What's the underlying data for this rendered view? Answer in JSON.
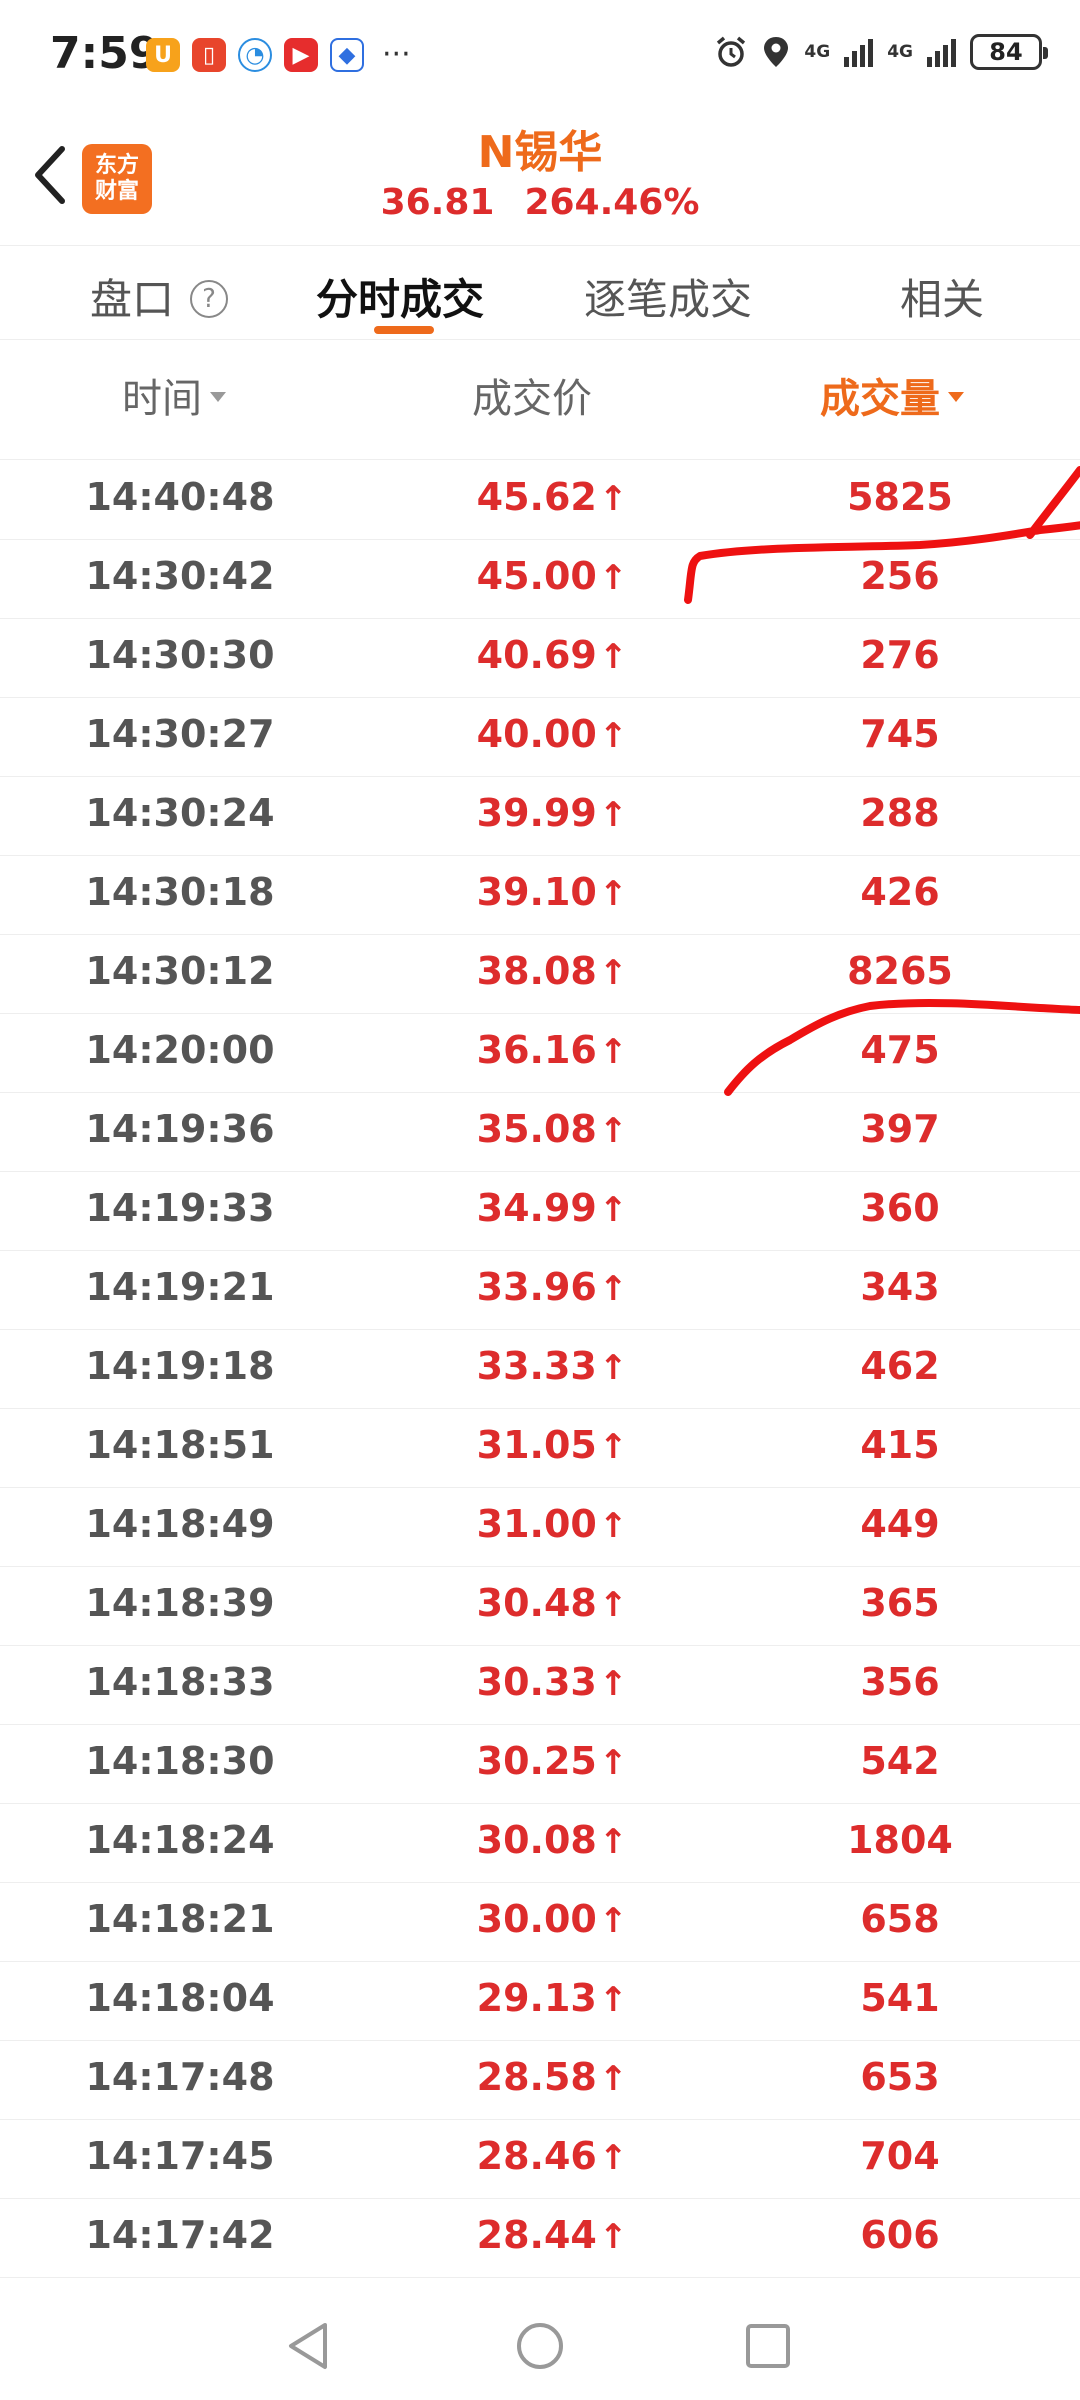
{
  "status_bar": {
    "time": "7:59",
    "apps": [
      "app-u-icon",
      "app-record-icon",
      "app-chat-icon",
      "app-video-icon",
      "app-map-icon"
    ],
    "more": "···",
    "network1": "4G",
    "network2": "4G",
    "battery": "84"
  },
  "header": {
    "logo_line1": "东方",
    "logo_line2": "财富",
    "title": "N锡华",
    "price": "36.81",
    "change_pct": "264.46%"
  },
  "tabs": {
    "pankou": "盘口",
    "help": "?",
    "fenshi": "分时成交",
    "zhubi": "逐笔成交",
    "xiangguan": "相关"
  },
  "columns": {
    "time": "时间",
    "price": "成交价",
    "volume": "成交量"
  },
  "trades": [
    {
      "time": "14:40:48",
      "price": "45.62",
      "volume": "5825"
    },
    {
      "time": "14:30:42",
      "price": "45.00",
      "volume": "256"
    },
    {
      "time": "14:30:30",
      "price": "40.69",
      "volume": "276"
    },
    {
      "time": "14:30:27",
      "price": "40.00",
      "volume": "745"
    },
    {
      "time": "14:30:24",
      "price": "39.99",
      "volume": "288"
    },
    {
      "time": "14:30:18",
      "price": "39.10",
      "volume": "426"
    },
    {
      "time": "14:30:12",
      "price": "38.08",
      "volume": "8265"
    },
    {
      "time": "14:20:00",
      "price": "36.16",
      "volume": "475"
    },
    {
      "time": "14:19:36",
      "price": "35.08",
      "volume": "397"
    },
    {
      "time": "14:19:33",
      "price": "34.99",
      "volume": "360"
    },
    {
      "time": "14:19:21",
      "price": "33.96",
      "volume": "343"
    },
    {
      "time": "14:19:18",
      "price": "33.33",
      "volume": "462"
    },
    {
      "time": "14:18:51",
      "price": "31.05",
      "volume": "415"
    },
    {
      "time": "14:18:49",
      "price": "31.00",
      "volume": "449"
    },
    {
      "time": "14:18:39",
      "price": "30.48",
      "volume": "365"
    },
    {
      "time": "14:18:33",
      "price": "30.33",
      "volume": "356"
    },
    {
      "time": "14:18:30",
      "price": "30.25",
      "volume": "542"
    },
    {
      "time": "14:18:24",
      "price": "30.08",
      "volume": "1804"
    },
    {
      "time": "14:18:21",
      "price": "30.00",
      "volume": "658"
    },
    {
      "time": "14:18:04",
      "price": "29.13",
      "volume": "541"
    },
    {
      "time": "14:17:48",
      "price": "28.58",
      "volume": "653"
    },
    {
      "time": "14:17:45",
      "price": "28.46",
      "volume": "704"
    },
    {
      "time": "14:17:42",
      "price": "28.44",
      "volume": "606"
    }
  ],
  "up_arrow": "↑",
  "colors": {
    "accent": "#ee6a1b",
    "up": "#dd2c2c",
    "logo": "#f36f21",
    "annotation": "#ee1111"
  }
}
